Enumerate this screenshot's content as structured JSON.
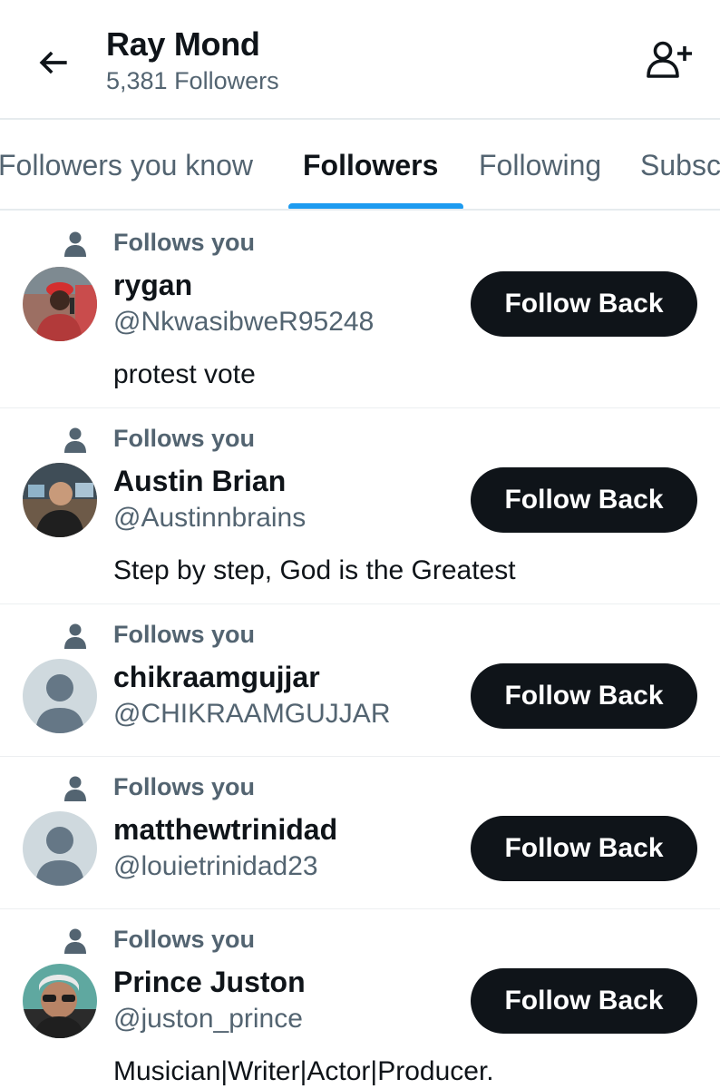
{
  "header": {
    "title": "Ray Mond",
    "subtitle": "5,381 Followers",
    "back_icon": "arrow-left-icon",
    "add_icon": "add-user-icon"
  },
  "tabs": [
    {
      "label": "Followers you know",
      "active": false
    },
    {
      "label": "Followers",
      "active": true
    },
    {
      "label": "Following",
      "active": false
    },
    {
      "label": "Subsc",
      "active": false
    }
  ],
  "colors": {
    "accent": "#1d9bf0",
    "text": "#0f1419",
    "muted": "#536471",
    "button": "#0f1419"
  },
  "followers": [
    {
      "follows_label": "Follows you",
      "name": "rygan",
      "handle": "@NkwasibweR95248",
      "bio": "protest vote",
      "button": "Follow Back",
      "avatar": "photo"
    },
    {
      "follows_label": "Follows you",
      "name": "Austin Brian",
      "handle": "@Austinnbrains",
      "bio": "Step by step, God is the Greatest",
      "button": "Follow Back",
      "avatar": "photo"
    },
    {
      "follows_label": "Follows you",
      "name": "chikraamgujjar",
      "handle": "@CHIKRAAMGUJJAR",
      "bio": "",
      "button": "Follow Back",
      "avatar": "default"
    },
    {
      "follows_label": "Follows you",
      "name": "matthewtrinidad",
      "handle": "@louietrinidad23",
      "bio": "",
      "button": "Follow Back",
      "avatar": "default"
    },
    {
      "follows_label": "Follows you",
      "name": "Prince Juston",
      "handle": "@juston_prince",
      "bio": "Musician|Writer|Actor|Producer.",
      "button": "Follow Back",
      "avatar": "photo"
    }
  ]
}
